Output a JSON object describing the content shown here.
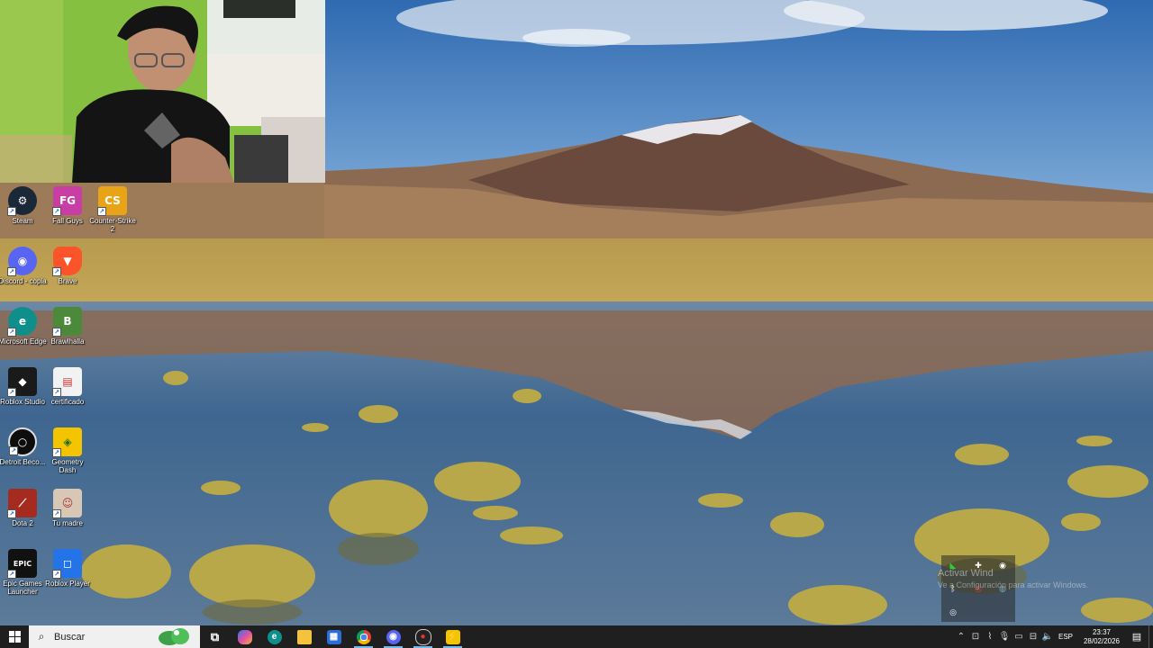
{
  "desktop": {
    "icons": [
      {
        "label": "Steam",
        "icon": "steam-icon",
        "color": "#1b2838"
      },
      {
        "label": "Fall Guys",
        "icon": "fall-guys-icon",
        "color": "#c93ea4"
      },
      {
        "label": "Counter-Strike 2",
        "icon": "counter-strike-icon",
        "color": "#e8a317"
      },
      {
        "label": "Discord - copia",
        "icon": "discord-icon",
        "color": "#5865f2"
      },
      {
        "label": "Brave",
        "icon": "brave-icon",
        "color": "#fb542b"
      },
      {
        "label": "Microsoft Edge",
        "icon": "edge-icon",
        "color": "#0f8f8c"
      },
      {
        "label": "Brawlhalla",
        "icon": "brawlhalla-icon",
        "color": "#4b8a3a"
      },
      {
        "label": "Roblox Studio",
        "icon": "roblox-studio-icon",
        "color": "#1a1a1a"
      },
      {
        "label": "certificado",
        "icon": "document-icon",
        "color": "#f2f2f2"
      },
      {
        "label": "Detroit Beco...",
        "icon": "detroit-icon",
        "color": "#0d0d0d"
      },
      {
        "label": "Geometry Dash",
        "icon": "geometry-dash-icon",
        "color": "#f5c400"
      },
      {
        "label": "Dota 2",
        "icon": "dota-icon",
        "color": "#a52a1f"
      },
      {
        "label": "Tu madre",
        "icon": "photo-icon",
        "color": "#d8c7b5"
      },
      {
        "label": "Epic Games Launcher",
        "icon": "epic-games-icon",
        "color": "#111111"
      },
      {
        "label": "Roblox Player",
        "icon": "roblox-player-icon",
        "color": "#2573e8"
      }
    ]
  },
  "watermark": {
    "title": "Activar Wind",
    "subtitle": "Ve a Configuración para activar Windows."
  },
  "taskbar": {
    "search_placeholder": "Buscar",
    "apps": [
      {
        "icon": "task-view-icon"
      },
      {
        "icon": "copilot-icon"
      },
      {
        "icon": "edge-icon"
      },
      {
        "icon": "file-explorer-icon"
      },
      {
        "icon": "store-icon"
      },
      {
        "icon": "chrome-icon"
      },
      {
        "icon": "discord-icon"
      },
      {
        "icon": "recorder-icon"
      },
      {
        "icon": "app-icon"
      }
    ],
    "language": "ESP",
    "time": "23:37",
    "date": "28/02/2026"
  }
}
